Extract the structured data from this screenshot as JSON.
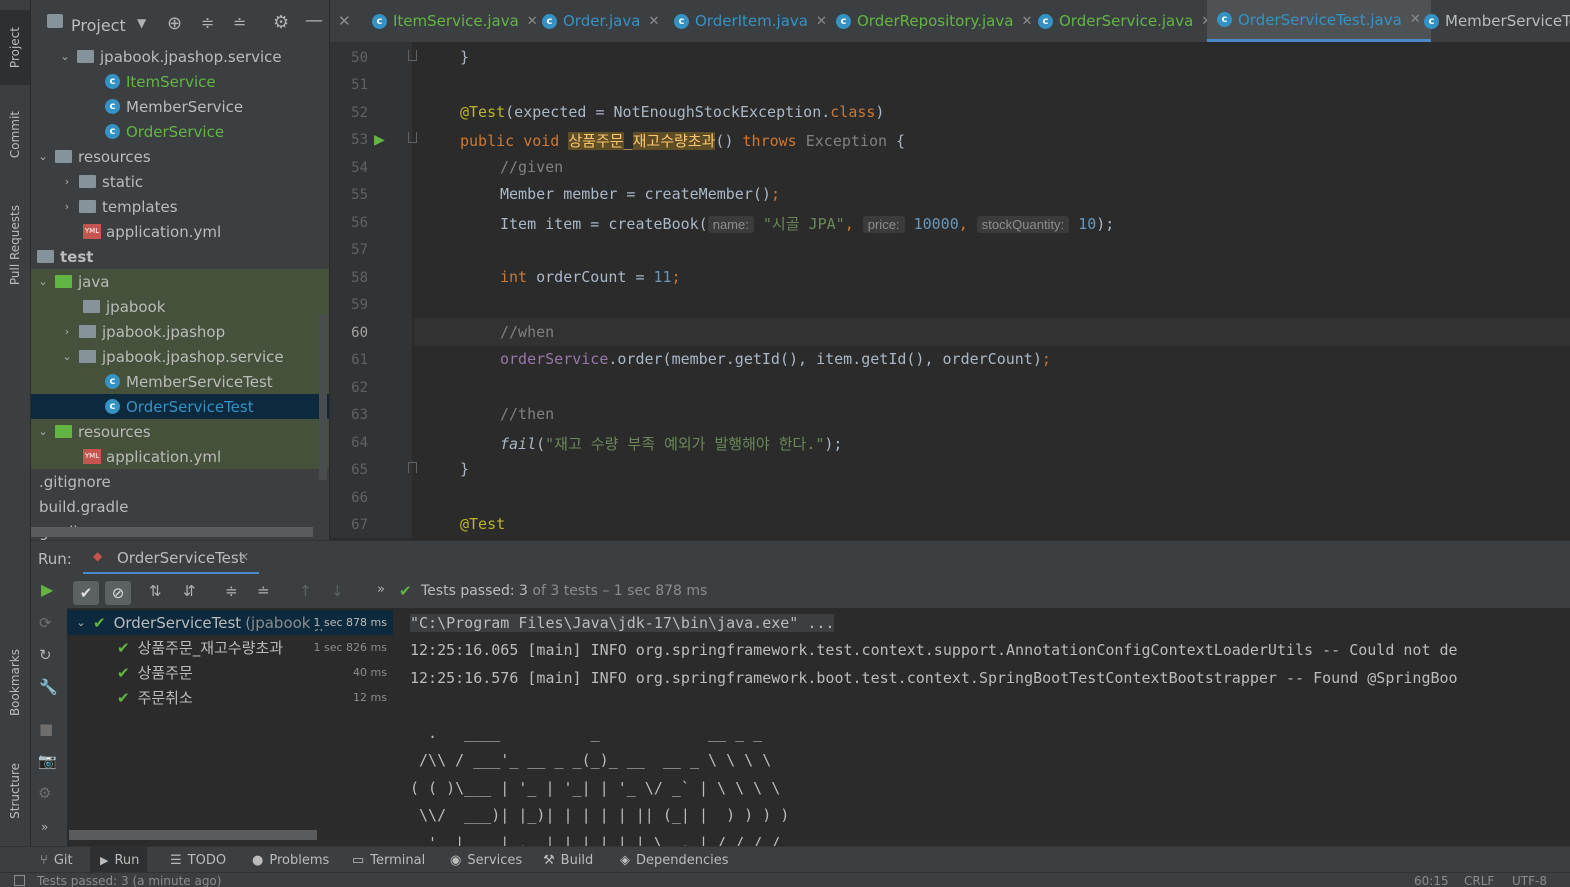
{
  "left_strip": {
    "project": "Project",
    "commit": "Commit",
    "pull_requests": "Pull Requests",
    "bookmarks": "Bookmarks",
    "structure": "Structure"
  },
  "project_pane": {
    "title": "Project",
    "items": [
      {
        "label": "jpabook.jpashop.service"
      },
      {
        "label": "ItemService"
      },
      {
        "label": "MemberService"
      },
      {
        "label": "OrderService"
      },
      {
        "label": "resources"
      },
      {
        "label": "static"
      },
      {
        "label": "templates"
      },
      {
        "label": "application.yml"
      },
      {
        "label": "test"
      },
      {
        "label": "java"
      },
      {
        "label": "jpabook"
      },
      {
        "label": "jpabook.jpashop"
      },
      {
        "label": "jpabook.jpashop.service"
      },
      {
        "label": "MemberServiceTest"
      },
      {
        "label": "OrderServiceTest"
      },
      {
        "label": "resources"
      },
      {
        "label": "application.yml"
      },
      {
        "label": ".gitignore"
      },
      {
        "label": "build.gradle"
      },
      {
        "label": "gradlew"
      }
    ]
  },
  "editor_tabs": [
    "ItemService.java",
    "Order.java",
    "OrderItem.java",
    "OrderRepository.java",
    "OrderService.java",
    "OrderServiceTest.java",
    "MemberServiceTe"
  ],
  "editor": {
    "line_numbers": [
      "50",
      "51",
      "52",
      "53",
      "54",
      "55",
      "56",
      "57",
      "58",
      "59",
      "60",
      "61",
      "62",
      "63",
      "64",
      "65",
      "66",
      "67"
    ],
    "current_line": "60",
    "tokens": {
      "brace_close": "}",
      "test_ann": "@Test",
      "expected_args": "(expected = NotEnoughStockException.",
      "class_kw": "class",
      "close_paren": ")",
      "public_void": "public void ",
      "method_name_a": "상품주문",
      "method_name_sep": "_",
      "method_name_b": "재고수량초과",
      "method_parens": "() ",
      "throws_kw": "throws",
      "exception": " Exception",
      "open_brace": " {",
      "c_given": "//given",
      "member_line": "Member member = createMember()",
      "semi": ";",
      "item_prefix": "Item item = createBook(",
      "hint_name": "name:",
      "str_jpa": "\"시골 JPA\"",
      "comma": ",",
      "hint_price": "price:",
      "num_10000": "10000",
      "hint_stock": "stockQuantity:",
      "num_10": "10",
      "close_paren_semi": ");",
      "int_kw": "int",
      "order_count_decl": " orderCount = ",
      "num_11": "11",
      "c_when": "//when",
      "order_service": "orderService",
      "order_call": ".order(member.getId(), item.getId(), orderCount)",
      "c_then": "//then",
      "fail_fn": "fail",
      "fail_open": "(",
      "fail_msg": "\"재고 수량 부족 예외가 발행해야 한다.\"",
      "test_ann2": "@Test"
    }
  },
  "run_panel": {
    "run_label": "Run:",
    "config_tab": "OrderServiceTest",
    "status_prefix": "Tests passed:",
    "status_count": "3",
    "status_rest": "of 3 tests – 1 sec 878 ms",
    "tests": [
      {
        "name": "OrderServiceTest",
        "pkg": "(jpabook.jp",
        "duration": "1 sec 878 ms"
      },
      {
        "name": "상품주문_재고수량초과",
        "duration": "1 sec 826 ms"
      },
      {
        "name": "상품주문",
        "duration": "40 ms"
      },
      {
        "name": "주문취소",
        "duration": "12 ms"
      }
    ],
    "console": [
      "\"C:\\Program Files\\Java\\jdk-17\\bin\\java.exe\" ...",
      "12:25:16.065 [main] INFO org.springframework.test.context.support.AnnotationConfigContextLoaderUtils -- Could not de",
      "12:25:16.576 [main] INFO org.springframework.boot.test.context.SpringBootTestContextBootstrapper -- Found @SpringBoo",
      "",
      "  .   ____          _            __ _ _",
      " /\\\\ / ___'_ __ _ _(_)_ __  __ _ \\ \\ \\ \\",
      "( ( )\\___ | '_ | '_| | '_ \\/ _` | \\ \\ \\ \\",
      " \\\\/  ___)| |_)| | | | | || (_| |  ) ) ) )",
      "  '  |____| .__|_| |_|_| |_\\__, | / / / /"
    ]
  },
  "bottom_tabs": [
    "Git",
    "Run",
    "TODO",
    "Problems",
    "Terminal",
    "Services",
    "Build",
    "Dependencies"
  ],
  "status_bar": {
    "left": "Tests passed: 3 (a minute ago)",
    "position": "60:15",
    "line_sep": "CRLF",
    "encoding": "UTF-8"
  },
  "colors": {
    "accent": "#4a88c7",
    "pass": "#62b543",
    "keyword": "#cc7832",
    "annotation": "#bbb529"
  }
}
